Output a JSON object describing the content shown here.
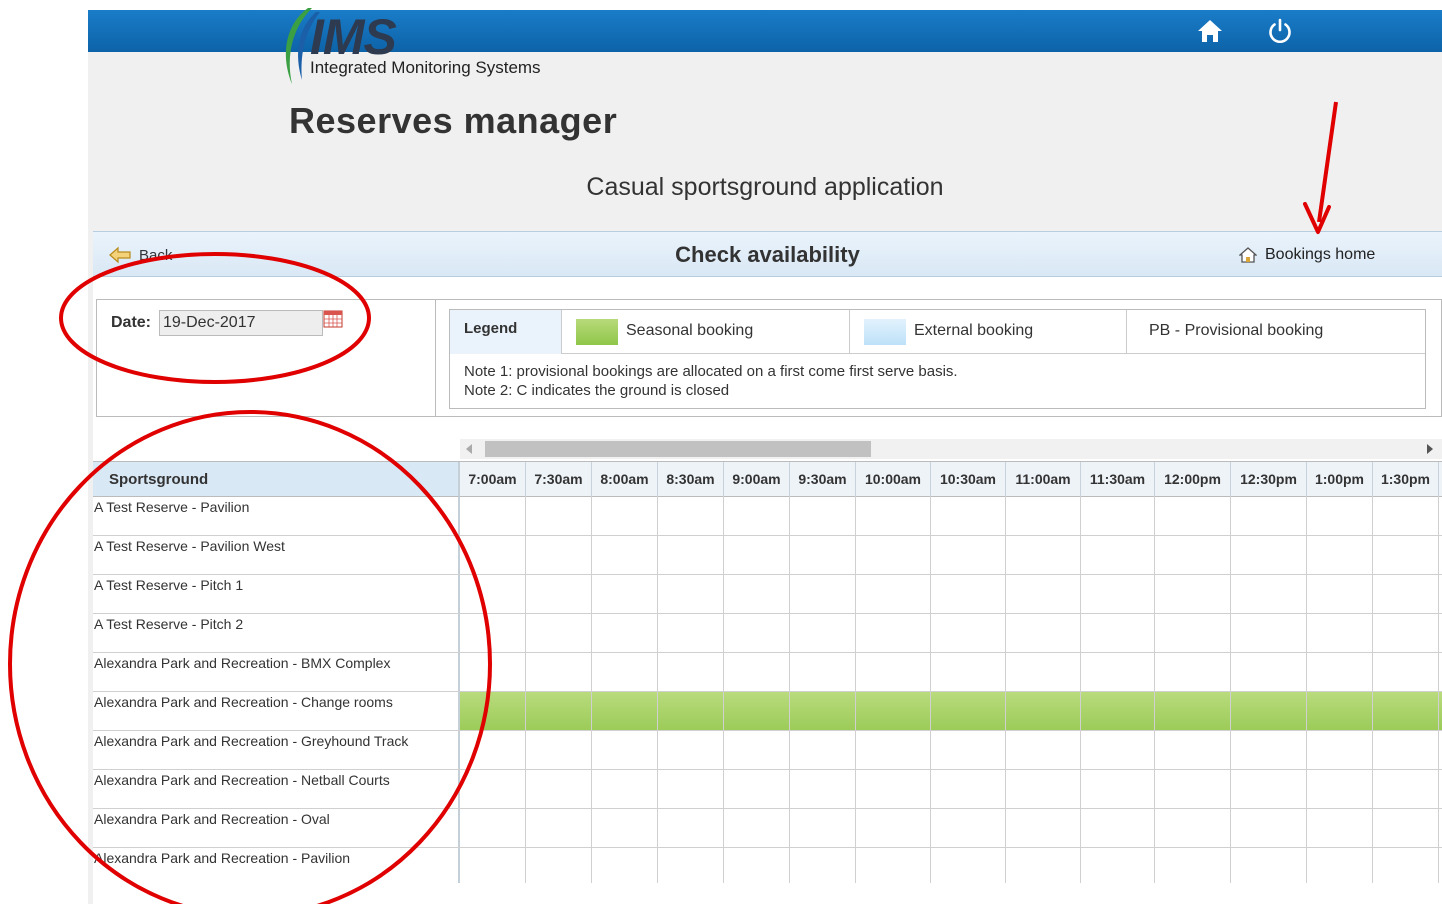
{
  "header": {
    "brand": "IMS",
    "tagline": "Integrated Monitoring Systems",
    "app_title": "Reserves manager",
    "app_subtitle": "Casual sportsground application",
    "top_icons": [
      "home-icon",
      "power-icon"
    ]
  },
  "titlebar": {
    "back_label": "Back",
    "heading": "Check availability",
    "bookings_home_label": "Bookings home"
  },
  "date": {
    "label": "Date:",
    "value": "19-Dec-2017"
  },
  "legend": {
    "header": "Legend",
    "seasonal": "Seasonal booking",
    "external": "External booking",
    "provisional": "PB - Provisional booking",
    "note1": "Note 1: provisional bookings are allocated on a first come first serve basis.",
    "note2": "Note 2: C indicates the ground is closed",
    "colors": {
      "seasonal": "#9ccc59",
      "external": "#bde1f8"
    }
  },
  "grid": {
    "sportsground_header": "Sportsground",
    "times": [
      "7:00am",
      "7:30am",
      "8:00am",
      "8:30am",
      "9:00am",
      "9:30am",
      "10:00am",
      "10:30am",
      "11:00am",
      "11:30am",
      "12:00pm",
      "12:30pm",
      "1:00pm",
      "1:30pm"
    ],
    "rows": [
      {
        "name": "A Test Reserve - Pavilion",
        "booking": ""
      },
      {
        "name": "A Test Reserve - Pavilion West",
        "booking": ""
      },
      {
        "name": "A Test Reserve - Pitch 1",
        "booking": ""
      },
      {
        "name": "A Test Reserve - Pitch 2",
        "booking": ""
      },
      {
        "name": "Alexandra Park and Recreation - BMX Complex",
        "booking": ""
      },
      {
        "name": "Alexandra Park and Recreation - Change rooms",
        "booking": "seasonal"
      },
      {
        "name": "Alexandra Park and Recreation - Greyhound Track",
        "booking": ""
      },
      {
        "name": "Alexandra Park and Recreation - Netball Courts",
        "booking": ""
      },
      {
        "name": "Alexandra Park and Recreation - Oval",
        "booking": ""
      },
      {
        "name": "Alexandra Park and Recreation - Pavilion",
        "booking": ""
      }
    ]
  },
  "annotation_color": "#e00000"
}
